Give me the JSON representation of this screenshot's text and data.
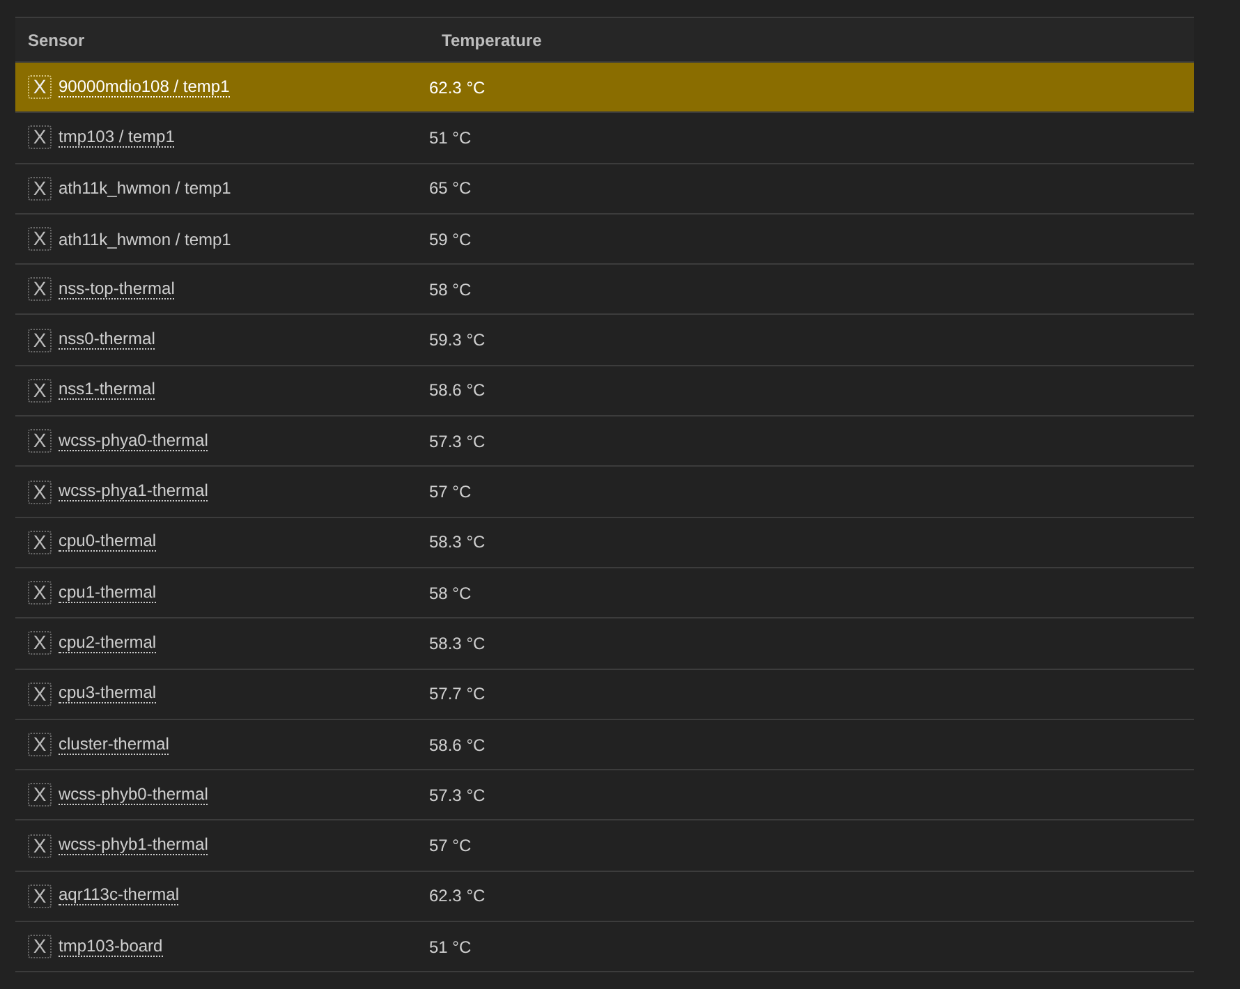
{
  "table": {
    "columns": [
      "Sensor",
      "Temperature"
    ],
    "rows": [
      {
        "remove": "X",
        "sensor": "90000mdio108 / temp1",
        "linked": true,
        "temperature": "62.3 °C",
        "selected": true
      },
      {
        "remove": "X",
        "sensor": "tmp103 / temp1",
        "linked": true,
        "temperature": "51 °C",
        "selected": false
      },
      {
        "remove": "X",
        "sensor": "ath11k_hwmon / temp1",
        "linked": false,
        "temperature": "65 °C",
        "selected": false
      },
      {
        "remove": "X",
        "sensor": "ath11k_hwmon / temp1",
        "linked": false,
        "temperature": "59 °C",
        "selected": false
      },
      {
        "remove": "X",
        "sensor": "nss-top-thermal",
        "linked": true,
        "temperature": "58 °C",
        "selected": false
      },
      {
        "remove": "X",
        "sensor": "nss0-thermal",
        "linked": true,
        "temperature": "59.3 °C",
        "selected": false
      },
      {
        "remove": "X",
        "sensor": "nss1-thermal",
        "linked": true,
        "temperature": "58.6 °C",
        "selected": false
      },
      {
        "remove": "X",
        "sensor": "wcss-phya0-thermal",
        "linked": true,
        "temperature": "57.3 °C",
        "selected": false
      },
      {
        "remove": "X",
        "sensor": "wcss-phya1-thermal",
        "linked": true,
        "temperature": "57 °C",
        "selected": false
      },
      {
        "remove": "X",
        "sensor": "cpu0-thermal",
        "linked": true,
        "temperature": "58.3 °C",
        "selected": false
      },
      {
        "remove": "X",
        "sensor": "cpu1-thermal",
        "linked": true,
        "temperature": "58 °C",
        "selected": false
      },
      {
        "remove": "X",
        "sensor": "cpu2-thermal",
        "linked": true,
        "temperature": "58.3 °C",
        "selected": false
      },
      {
        "remove": "X",
        "sensor": "cpu3-thermal",
        "linked": true,
        "temperature": "57.7 °C",
        "selected": false
      },
      {
        "remove": "X",
        "sensor": "cluster-thermal",
        "linked": true,
        "temperature": "58.6 °C",
        "selected": false
      },
      {
        "remove": "X",
        "sensor": "wcss-phyb0-thermal",
        "linked": true,
        "temperature": "57.3 °C",
        "selected": false
      },
      {
        "remove": "X",
        "sensor": "wcss-phyb1-thermal",
        "linked": true,
        "temperature": "57 °C",
        "selected": false
      },
      {
        "remove": "X",
        "sensor": "aqr113c-thermal",
        "linked": true,
        "temperature": "62.3 °C",
        "selected": false
      },
      {
        "remove": "X",
        "sensor": "tmp103-board",
        "linked": true,
        "temperature": "51 °C",
        "selected": false
      }
    ]
  }
}
